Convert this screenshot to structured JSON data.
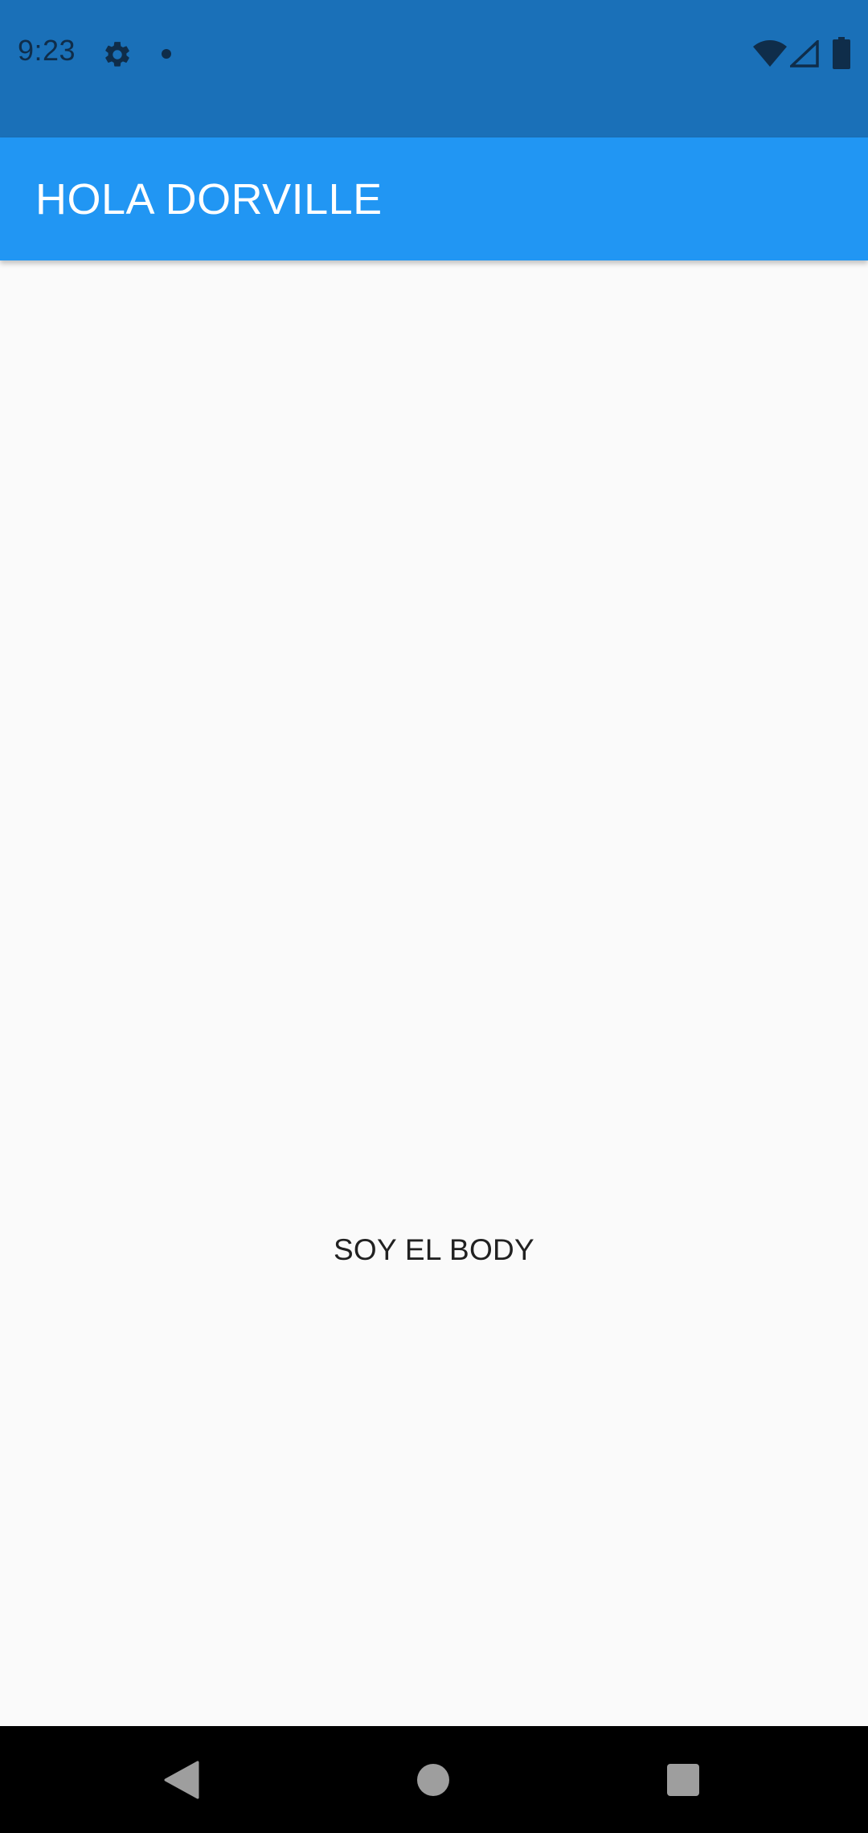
{
  "status_bar": {
    "time": "9:23",
    "icons": [
      "gear-icon",
      "notification-dot-icon",
      "wifi-icon",
      "cell-signal-icon",
      "battery-icon"
    ],
    "background_color": "#1a70b8"
  },
  "app_bar": {
    "title": "HOLA DORVILLE",
    "background_color": "#2196f3"
  },
  "body": {
    "text": "SOY EL BODY",
    "background_color": "#fafafa"
  },
  "nav_bar": {
    "buttons": [
      "back-icon",
      "home-icon",
      "recents-icon"
    ],
    "background_color": "#000000"
  }
}
